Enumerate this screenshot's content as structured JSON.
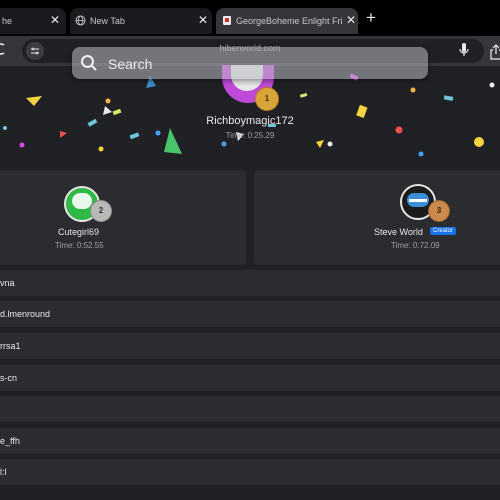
{
  "tabs": [
    {
      "title": "he",
      "active": false
    },
    {
      "title": "New Tab",
      "active": false
    },
    {
      "title": "GeorgeBoheme Enlight Fri",
      "active": true
    }
  ],
  "newtab_label": "+",
  "omnibox": {
    "url": "hiberworld.com"
  },
  "search": {
    "placeholder": "Search"
  },
  "winner": {
    "name": "Richboymagic172",
    "time": "Time: 0:25.29",
    "place": "1"
  },
  "podium": [
    {
      "name": "Cutegirl69",
      "time": "Time: 0:52.55",
      "place": "2",
      "badge": ""
    },
    {
      "name": "Steve World",
      "time": "Time: 0:72.09",
      "place": "3",
      "badge": "Creator"
    }
  ],
  "list": [
    "vna",
    "d.lmenround",
    "rrsa1",
    "s-cn",
    "",
    "e_ffh",
    "l:l"
  ],
  "colors": {
    "accent": "#1a73e8",
    "gold": "#d9a43a",
    "silver": "#b9b9b9",
    "bronze": "#c98a4b"
  }
}
